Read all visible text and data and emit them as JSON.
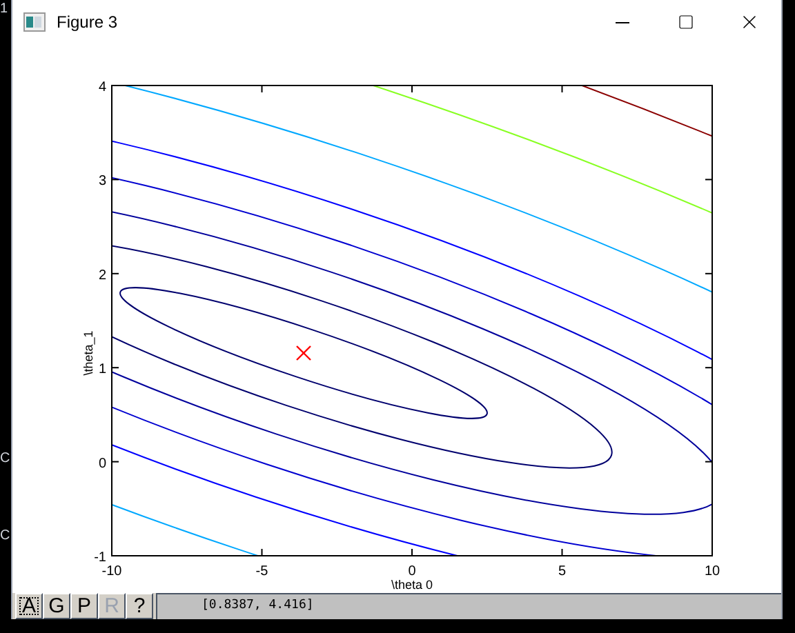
{
  "desktop_fragments": [
    "1",
    "C",
    "C"
  ],
  "window": {
    "title": "Figure 3"
  },
  "plot": {
    "xlabel": "\\theta 0",
    "ylabel": "\\theta_1",
    "xticks": [
      "-10",
      "-5",
      "0",
      "5",
      "10"
    ],
    "yticks": [
      "4",
      "3",
      "2",
      "1",
      "0",
      "-1"
    ]
  },
  "toolbar": {
    "buttons": [
      {
        "label": "A",
        "disabled": false,
        "focused": true
      },
      {
        "label": "G",
        "disabled": false,
        "focused": false
      },
      {
        "label": "P",
        "disabled": false,
        "focused": false
      },
      {
        "label": "R",
        "disabled": true,
        "focused": false
      },
      {
        "label": "?",
        "disabled": false,
        "focused": false
      }
    ],
    "coordinates": "[0.8387, 4.416]"
  }
}
